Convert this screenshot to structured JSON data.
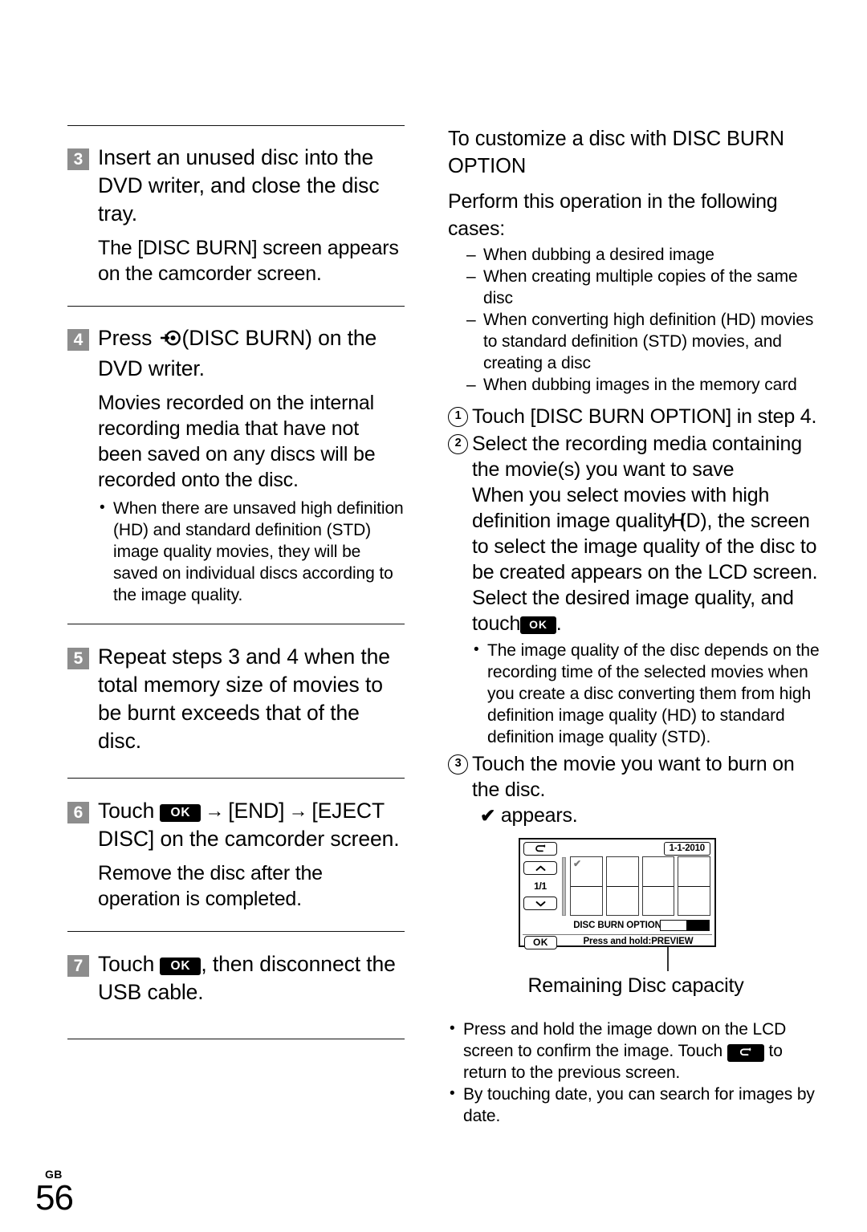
{
  "page": {
    "number": "56",
    "region_code": "GB"
  },
  "left_column": {
    "steps": [
      {
        "number": "3",
        "heading": "Insert an unused disc into the DVD writer, and close the disc tray.",
        "body": "The [DISC BURN] screen appears on the camcorder screen."
      },
      {
        "number": "4",
        "heading_before": "Press",
        "heading_icon": "disc-burn-icon",
        "heading_after": "(DISC BURN) on the DVD writer.",
        "body": "Movies recorded on the internal recording media that have not been saved on any discs will be recorded onto the disc.",
        "bullets": [
          "When there are unsaved high definition (HD) and standard definition (STD) image quality movies, they will be saved on individual discs according to the image quality."
        ]
      },
      {
        "number": "5",
        "heading": "Repeat steps 3 and 4 when the total memory size of movies to be burnt exceeds that of the disc."
      },
      {
        "number": "6",
        "heading_before": "Touch",
        "ok_label": "OK",
        "arrow": "→",
        "heading_mid": "[END]",
        "heading_after": "[EJECT DISC] on the camcorder screen.",
        "body": "Remove the disc after the operation is completed."
      },
      {
        "number": "7",
        "heading_before": "Touch",
        "ok_label": "OK",
        "heading_after": ", then disconnect the USB cable."
      }
    ]
  },
  "right_column": {
    "section_title": "To customize a disc with DISC BURN OPTION",
    "intro": "Perform this operation in the following cases:",
    "cases": [
      "When dubbing a desired image",
      "When creating multiple copies of the same disc",
      "When converting high definition (HD) movies to standard definition (STD) movies, and creating a disc",
      "When dubbing images in the memory card"
    ],
    "numbered": {
      "item1": "Touch [DISC BURN OPTION] in step 4.",
      "item2_line1": "Select the recording media containing the movie(s) you want to save",
      "item2_body_a": "When you select movies with high definition image quality",
      "item2_body_hd": "H",
      "item2_body_b": "(D), the screen to select the image quality of the disc to be created appears on the LCD screen. Select the desired image quality, and touch",
      "item2_ok": "OK",
      "item2_period": ".",
      "item2_bullets": [
        "The image quality of the disc depends on the recording time of the selected movies when you create a disc converting them from high definition image quality (HD) to standard definition image quality (STD)."
      ],
      "item3": "Touch the movie you want to burn on the disc.",
      "item3_note_check": "✔",
      "item3_note_text": "appears."
    },
    "lcd": {
      "back_icon": "↶",
      "up_icon": "⌃",
      "down_icon": "⌄",
      "page_indicator": "1/1",
      "date": "1-1-2010",
      "thumb_check": "✔",
      "title": "DISC BURN OPTION",
      "ok_label": "OK",
      "preview_text": "Press and hold:PREVIEW"
    },
    "lcd_caption": "Remaining Disc capacity",
    "bottom_bullets": [
      {
        "text_before": "Press and hold the image down on the LCD screen to confirm the image. Touch",
        "icon": "back-arrow-icon",
        "text_after": "to return to the previous screen."
      },
      {
        "text_before": "By touching date, you can search for images by date.",
        "icon": "",
        "text_after": ""
      }
    ]
  }
}
